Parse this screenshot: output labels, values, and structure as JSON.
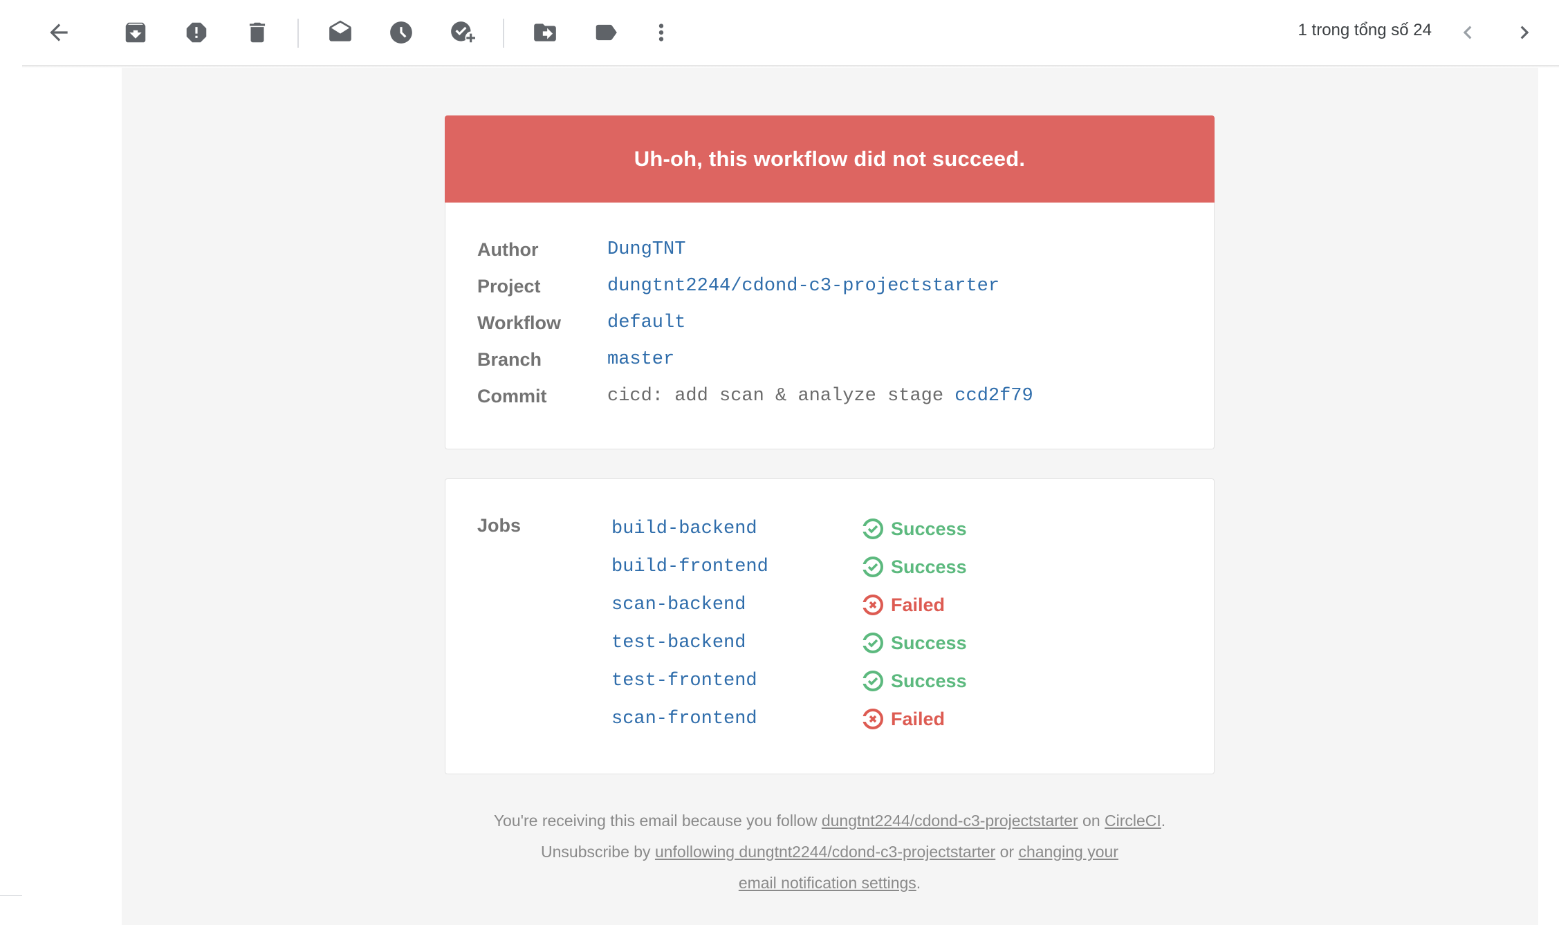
{
  "toolbar": {
    "icons": [
      "back-arrow-icon",
      "archive-icon",
      "report-spam-icon",
      "delete-icon",
      "mark-unread-icon",
      "snooze-icon",
      "add-to-tasks-icon",
      "move-to-icon",
      "label-icon",
      "more-options-icon",
      "newer-chevron-icon",
      "older-chevron-icon"
    ],
    "pager_text": "1 trong tổng số 24"
  },
  "email": {
    "banner": "Uh-oh, this workflow did not succeed.",
    "details": {
      "author_label": "Author",
      "author_value": "DungTNT",
      "project_label": "Project",
      "project_value": "dungtnt2244/cdond-c3-projectstarter",
      "workflow_label": "Workflow",
      "workflow_value": "default",
      "branch_label": "Branch",
      "branch_value": "master",
      "commit_label": "Commit",
      "commit_message": "cicd: add scan & analyze stage",
      "commit_hash": "ccd2f79"
    },
    "jobs_label": "Jobs",
    "jobs": [
      {
        "name": "build-backend",
        "status": "Success"
      },
      {
        "name": "build-frontend",
        "status": "Success"
      },
      {
        "name": "scan-backend",
        "status": "Failed"
      },
      {
        "name": "test-backend",
        "status": "Success"
      },
      {
        "name": "test-frontend",
        "status": "Success"
      },
      {
        "name": "scan-frontend",
        "status": "Failed"
      }
    ],
    "footer": {
      "line1_prefix": "You're receiving this email because you follow ",
      "line1_link": "dungtnt2244/cdond-c3-projectstarter",
      "line1_mid": " on ",
      "line1_link2": "CircleCI",
      "line1_end": ".",
      "line2_prefix": "Unsubscribe by ",
      "line2_link": "unfollowing dungtnt2244/cdond-c3-projectstarter",
      "line2_mid": " or ",
      "line2_link2": "changing your email notification settings",
      "line2_end": "."
    }
  },
  "colors": {
    "banner_red": "#dd6561",
    "link_blue": "#2f6dab",
    "success_green": "#5cb97e",
    "failed_red": "#dd5b52",
    "email_background": "#f5f5f5"
  }
}
